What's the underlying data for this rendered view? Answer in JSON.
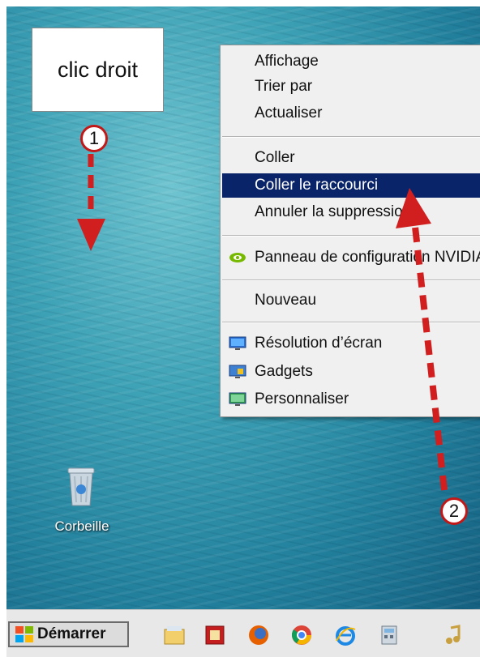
{
  "callout": {
    "text": "clic droit"
  },
  "badges": {
    "first": "1",
    "second": "2"
  },
  "context_menu": {
    "items": [
      {
        "label": "Affichage"
      },
      {
        "label": "Trier par"
      },
      {
        "label": "Actualiser"
      },
      {
        "label": "Coller"
      },
      {
        "label": "Coller le raccourci",
        "highlighted": true
      },
      {
        "label": "Annuler la suppression"
      },
      {
        "label": "Panneau de configuration NVIDIA",
        "icon": "nvidia-icon"
      },
      {
        "label": "Nouveau"
      },
      {
        "label": "Résolution d’écran",
        "icon": "display-resolution-icon"
      },
      {
        "label": "Gadgets",
        "icon": "gadgets-icon"
      },
      {
        "label": "Personnaliser",
        "icon": "personalize-icon"
      }
    ]
  },
  "desktop": {
    "recycle_bin_label": "Corbeille"
  },
  "taskbar": {
    "start_label": "Démarrer",
    "icons": [
      "file-explorer-icon",
      "flash-app-icon",
      "firefox-icon",
      "chrome-icon",
      "internet-explorer-icon",
      "calculator-icon",
      "media-player-icon"
    ]
  },
  "colors": {
    "highlight": "#0a246a",
    "annotation_red": "#d11f1f"
  }
}
